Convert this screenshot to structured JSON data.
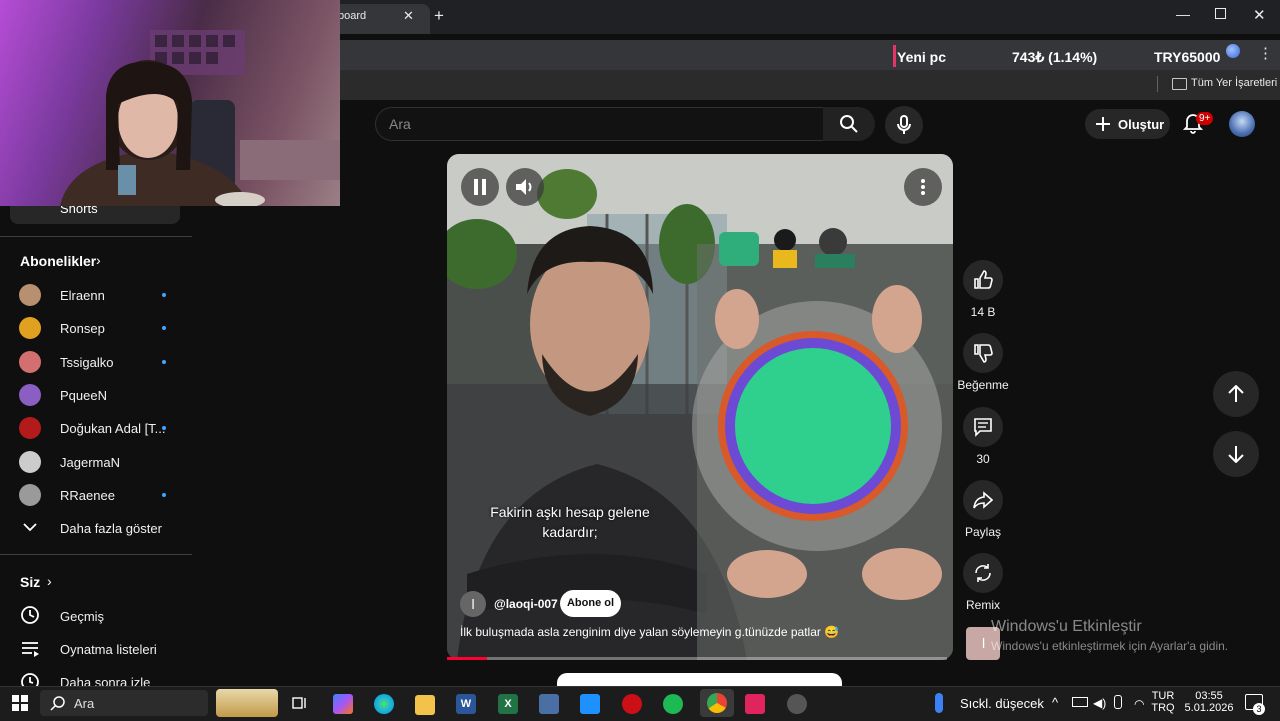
{
  "browser": {
    "tab_title": "board",
    "tab_close": "✕",
    "new_tab": "+",
    "window_controls": {
      "minimize": "—",
      "maximize": "",
      "close": "✕"
    },
    "ticker": {
      "name": "Yeni pc",
      "value": "743₺ (1.14%)",
      "price": "TRY65000"
    },
    "bookmarks_label": "Tüm Yer İşaretleri"
  },
  "youtube": {
    "search_placeholder": "Ara",
    "create_label": "Oluştur",
    "notification_count": "9+"
  },
  "sidebar": {
    "shorts_label": "Shorts",
    "subscriptions_title": "Abonelikler",
    "subscriptions": [
      {
        "name": "Elraenn",
        "new": true,
        "color": "#b89070"
      },
      {
        "name": "Ronsep",
        "new": true,
        "color": "#e0a020"
      },
      {
        "name": "Tssigalko",
        "new": true,
        "color": "#d27070"
      },
      {
        "name": "PqueeN",
        "new": false,
        "color": "#8a5ec2"
      },
      {
        "name": "Doğukan Adal [T...",
        "new": true,
        "color": "#b31b1b"
      },
      {
        "name": "JagermaN",
        "new": false,
        "color": "#cccccc"
      },
      {
        "name": "RRaenee",
        "new": true,
        "color": "#9a9a9a"
      }
    ],
    "show_more": "Daha fazla göster",
    "you_title": "Siz",
    "you_items": [
      "Geçmiş",
      "Oynatma listeleri",
      "Daha sonra izle"
    ]
  },
  "short": {
    "subtitle_line1": "Fakirin aşkı hesap gelene",
    "subtitle_line2": "kadardır;",
    "channel_initial": "l",
    "channel": "@laoqi-007",
    "subscribe": "Abone ol",
    "caption": "İlk buluşmada asla zenginim diye yalan söylemeyin g.tünüzde patlar 😅",
    "progress": 0.08
  },
  "actions": {
    "likes": "14 B",
    "dislike": "Beğenme",
    "comments": "30",
    "share": "Paylaş",
    "remix": "Remix",
    "remix_thumb_initial": "l"
  },
  "watermark": {
    "title": "Windows'u Etkinleştir",
    "subtitle": "Windows'u etkinleştirmek için Ayarlar'a gidin."
  },
  "taskbar": {
    "search": "Ara",
    "weather": "Sıckl. düşecek",
    "lang_top": "TUR",
    "lang_bottom": "TRQ",
    "time": "03:55",
    "date": "5.01.2026",
    "notifications": "3"
  }
}
